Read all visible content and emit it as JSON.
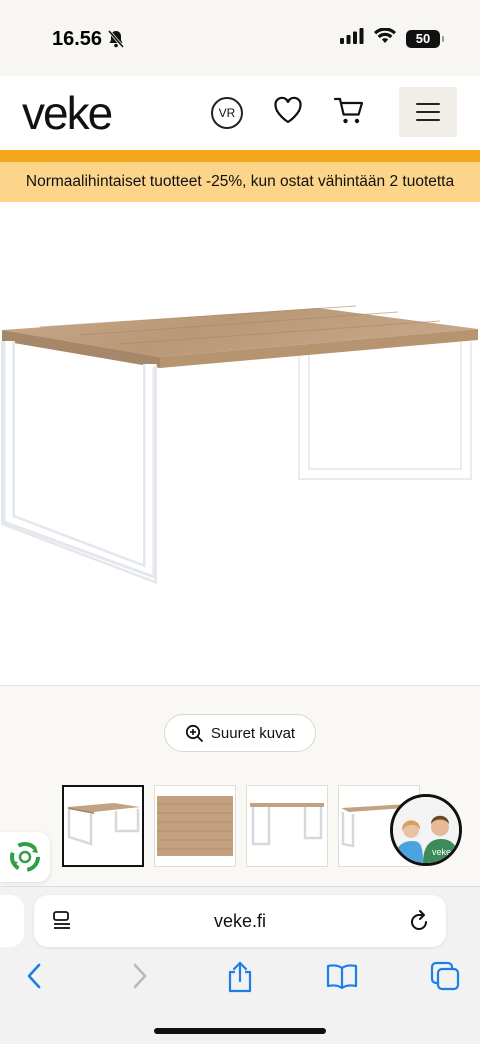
{
  "status_bar": {
    "time": "16.56",
    "battery": "50",
    "icons": [
      "bell-slash-icon",
      "signal-icon",
      "wifi-icon",
      "battery-icon"
    ]
  },
  "header": {
    "logo": "veke",
    "vr_label": "VR",
    "icons": [
      "vr-icon",
      "heart-icon",
      "cart-icon",
      "menu-icon"
    ]
  },
  "promo": {
    "text": "Normaalihintaiset tuotteet -25%, kun ostat vähintään 2 tuotetta",
    "accent": "#f5a71c",
    "background": "#fcd58a"
  },
  "gallery": {
    "zoom_label": "Suuret kuvat",
    "thumbnails": [
      "table-front",
      "tabletop-texture",
      "table-side",
      "table-angle"
    ],
    "active_thumbnail": 0
  },
  "chat": {
    "avatar_text": "veke"
  },
  "browser": {
    "url": "veke.fi",
    "icons": [
      "reader-icon",
      "reload-icon",
      "back-icon",
      "forward-icon",
      "share-icon",
      "bookmarks-icon",
      "tabs-icon"
    ],
    "accent": "#1a7fe8"
  }
}
